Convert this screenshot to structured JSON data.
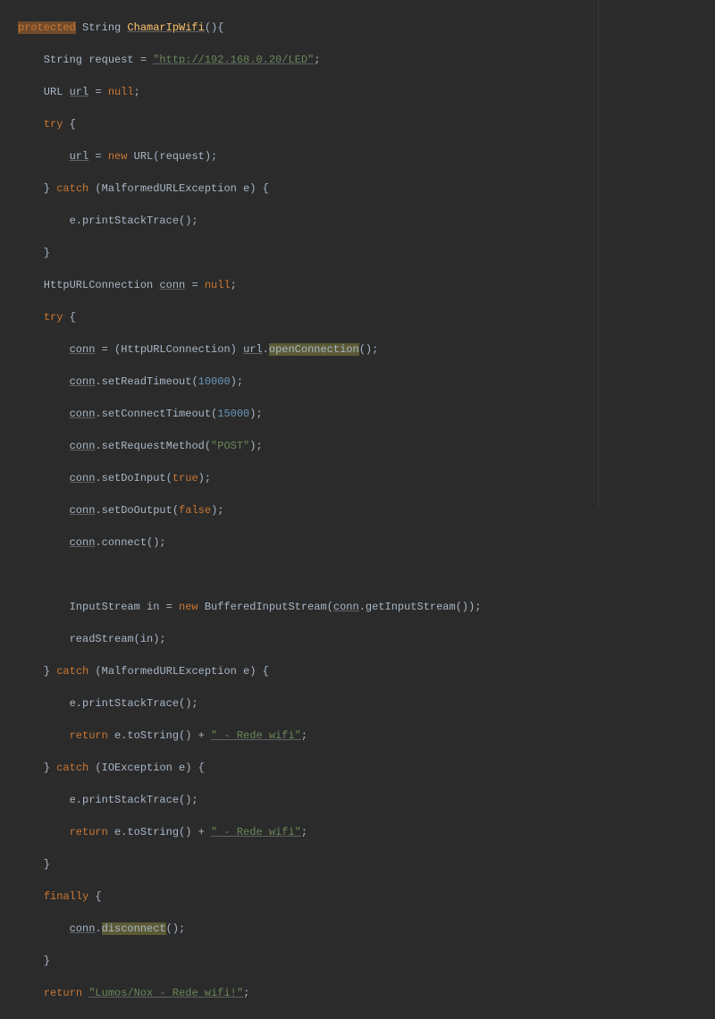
{
  "code": {
    "l1_protected": "protected",
    "l1_rest": " String ",
    "l1_fn": "ChamarIpWifi",
    "l1_paren": "(){",
    "l2a": "    String request = ",
    "l2s": "\"http://192.168.0.20/LED\"",
    "l2b": ";",
    "l3a": "    URL ",
    "l3u": "url",
    "l3b": " = ",
    "l3n": "null",
    "l3c": ";",
    "l4a": "    ",
    "l4k": "try",
    "l4b": " {",
    "l5a": "        ",
    "l5u": "url",
    "l5b": " = ",
    "l5k": "new",
    "l5c": " URL(request);",
    "l6a": "    } ",
    "l6k": "catch",
    "l6b": " (MalformedURLException e) {",
    "l7": "        e.printStackTrace();",
    "l8": "    }",
    "l9a": "    HttpURLConnection ",
    "l9u": "conn",
    "l9b": " = ",
    "l9n": "null",
    "l9c": ";",
    "l10a": "    ",
    "l10k": "try",
    "l10b": " {",
    "l11a": "        ",
    "l11u1": "conn",
    "l11b": " = (HttpURLConnection) ",
    "l11u2": "url",
    "l11c": ".",
    "l11hl": "openConnection",
    "l11d": "();",
    "l12a": "        ",
    "l12u": "conn",
    "l12b": ".setReadTimeout(",
    "l12n": "10000",
    "l12c": ");",
    "l13a": "        ",
    "l13u": "conn",
    "l13b": ".setConnectTimeout(",
    "l13n": "15000",
    "l13c": ");",
    "l14a": "        ",
    "l14u": "conn",
    "l14b": ".setRequestMethod(",
    "l14s": "\"POST\"",
    "l14c": ");",
    "l15a": "        ",
    "l15u": "conn",
    "l15b": ".setDoInput(",
    "l15k": "true",
    "l15c": ");",
    "l16a": "        ",
    "l16u": "conn",
    "l16b": ".setDoOutput(",
    "l16k": "false",
    "l16c": ");",
    "l17a": "        ",
    "l17u": "conn",
    "l17b": ".connect();",
    "l18": " ",
    "l19a": "        InputStream in = ",
    "l19k": "new",
    "l19b": " BufferedInputStream(",
    "l19u": "conn",
    "l19c": ".getInputStream());",
    "l20": "        readStream(in);",
    "l21a": "    } ",
    "l21k": "catch",
    "l21b": " (MalformedURLException e) {",
    "l22": "        e.printStackTrace();",
    "l23a": "        ",
    "l23k": "return",
    "l23b": " e.toString() + ",
    "l23s": "\" - Rede wifi\"",
    "l23c": ";",
    "l24a": "    } ",
    "l24k": "catch",
    "l24b": " (IOException e) {",
    "l25": "        e.printStackTrace();",
    "l26a": "        ",
    "l26k": "return",
    "l26b": " e.toString() + ",
    "l26s": "\" - Rede wifi\"",
    "l26c": ";",
    "l27": "    }",
    "l28a": "    ",
    "l28k": "finally",
    "l28b": " {",
    "l29a": "        ",
    "l29u": "conn",
    "l29b": ".",
    "l29hl": "disconnect",
    "l29c": "();",
    "l30": "    }",
    "l31a": "    ",
    "l31k": "return",
    "l31b": " ",
    "l31s": "\"Lumos/Nox - Rede wifi!\"",
    "l31c": ";"
  }
}
